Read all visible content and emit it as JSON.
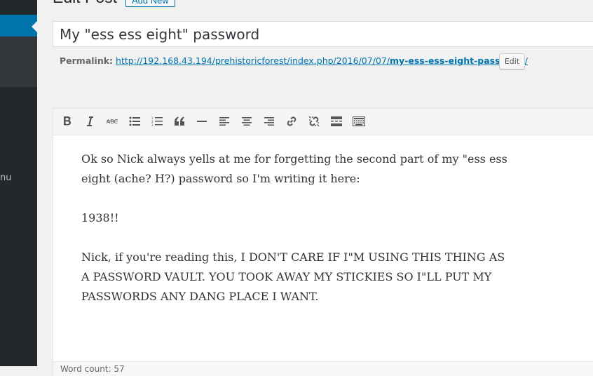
{
  "page": {
    "heading": "Edit Post",
    "add_new_label": "Add New"
  },
  "sidebar": {
    "menu_label_fragment": "nu"
  },
  "post": {
    "title": "My \"ess ess eight\" password",
    "permalink_label": "Permalink:",
    "permalink_base": "http://192.168.43.194/prehistoricforest/index.php/2016/07/07/",
    "permalink_slug": "my-ess-ess-eight-password",
    "permalink_trailing": "/",
    "permalink_edit_label": "Edit"
  },
  "toolbar": {
    "buttons": [
      "bold-icon",
      "italic-icon",
      "strikethrough-icon",
      "bulleted-list-icon",
      "numbered-list-icon",
      "blockquote-icon",
      "horizontal-line-icon",
      "align-left-icon",
      "align-center-icon",
      "align-right-icon",
      "insert-link-icon",
      "remove-link-icon",
      "read-more-icon",
      "toolbar-toggle-icon"
    ],
    "strike_glyph": "ABC"
  },
  "content": {
    "paragraphs": [
      "Ok so Nick always yells at me for forgetting the second part of my \"ess ess eight (ache? H?) password so I'm writing it here:",
      "1938!!",
      "Nick, if you're reading this, I DON'T CARE IF I\"M USING THIS THING AS A PASSWORD VAULT. YOU TOOK AWAY MY STICKIES SO I\"LL PUT MY PASSWORDS ANY DANG PLACE I WANT."
    ]
  },
  "footer": {
    "word_count": "Word count: 57"
  },
  "colors": {
    "sidebar_bg": "#23282d",
    "accent": "#0073aa",
    "page_bg": "#f1f1f1"
  }
}
